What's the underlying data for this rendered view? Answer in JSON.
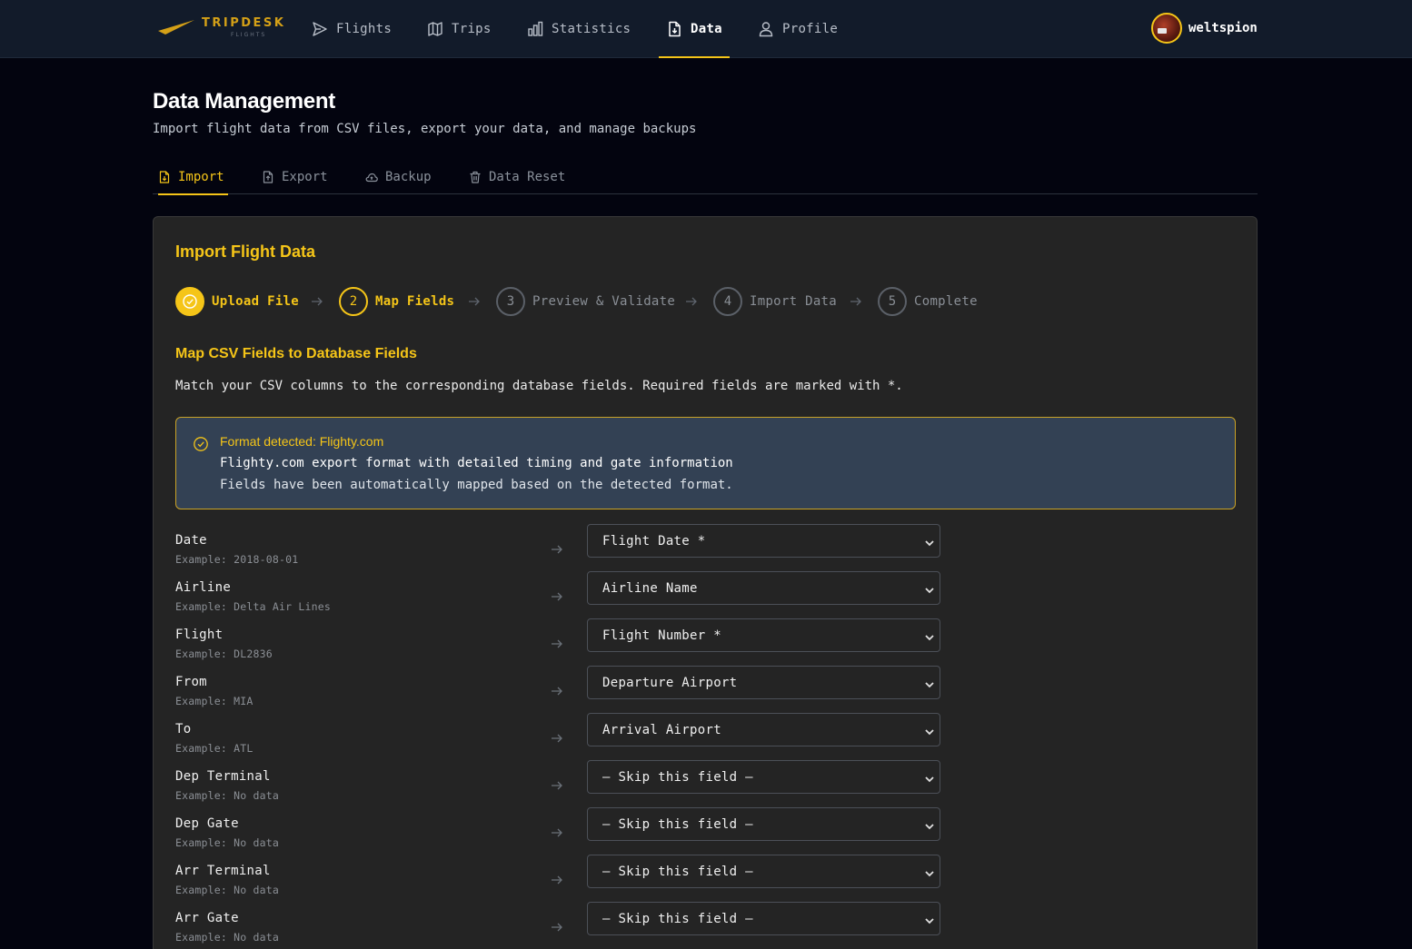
{
  "nav": {
    "brand": "TRIPDESK",
    "brand_sub": "FLIGHTS",
    "items": [
      {
        "label": "Flights",
        "icon": "send-icon"
      },
      {
        "label": "Trips",
        "icon": "map-icon"
      },
      {
        "label": "Statistics",
        "icon": "bar-chart-icon"
      },
      {
        "label": "Data",
        "icon": "file-import-icon",
        "active": true
      },
      {
        "label": "Profile",
        "icon": "user-icon"
      }
    ],
    "username": "weltspion"
  },
  "header": {
    "title": "Data Management",
    "subtitle": "Import flight data from CSV files, export your data, and manage backups"
  },
  "tabs": [
    {
      "label": "Import",
      "icon": "file-import-icon",
      "active": true
    },
    {
      "label": "Export",
      "icon": "file-export-icon"
    },
    {
      "label": "Backup",
      "icon": "cloud-icon"
    },
    {
      "label": "Data Reset",
      "icon": "trash-icon"
    }
  ],
  "import": {
    "title": "Import Flight Data",
    "steps": [
      {
        "num": "1",
        "label": "Upload File",
        "state": "done"
      },
      {
        "num": "2",
        "label": "Map Fields",
        "state": "current"
      },
      {
        "num": "3",
        "label": "Preview & Validate",
        "state": "pending"
      },
      {
        "num": "4",
        "label": "Import Data",
        "state": "pending"
      },
      {
        "num": "5",
        "label": "Complete",
        "state": "pending"
      }
    ],
    "section_title": "Map CSV Fields to Database Fields",
    "section_desc": "Match your CSV columns to the corresponding database fields. Required fields are marked with *.",
    "alert": {
      "title": "Format detected: Flighty.com",
      "line1": "Flighty.com export format with detailed timing and gate information",
      "line2": "Fields have been automatically mapped based on the detected format."
    },
    "mappings": [
      {
        "field": "Date",
        "example": "Example: 2018-08-01",
        "selected": "Flight Date *"
      },
      {
        "field": "Airline",
        "example": "Example: Delta Air Lines",
        "selected": "Airline Name"
      },
      {
        "field": "Flight",
        "example": "Example: DL2836",
        "selected": "Flight Number *"
      },
      {
        "field": "From",
        "example": "Example: MIA",
        "selected": "Departure Airport"
      },
      {
        "field": "To",
        "example": "Example: ATL",
        "selected": "Arrival Airport"
      },
      {
        "field": "Dep Terminal",
        "example": "Example: No data",
        "selected": "— Skip this field —"
      },
      {
        "field": "Dep Gate",
        "example": "Example: No data",
        "selected": "— Skip this field —"
      },
      {
        "field": "Arr Terminal",
        "example": "Example: No data",
        "selected": "— Skip this field —"
      },
      {
        "field": "Arr Gate",
        "example": "Example: No data",
        "selected": "— Skip this field —"
      }
    ]
  },
  "colors": {
    "accent": "#f5c518",
    "nav_bg": "#121b2a",
    "page_bg": "#03040f",
    "card_bg": "#242424",
    "alert_bg": "#334154"
  }
}
